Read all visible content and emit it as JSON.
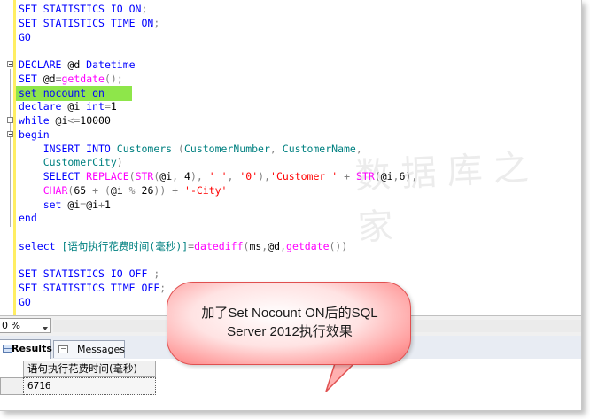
{
  "editor": {
    "lines": [
      {
        "segments": [
          {
            "t": "SET STATISTICS IO ON",
            "c": "k"
          },
          {
            "t": ";",
            "c": "g"
          }
        ]
      },
      {
        "segments": [
          {
            "t": "SET STATISTICS TIME ON",
            "c": "k"
          },
          {
            "t": ";",
            "c": "g"
          }
        ]
      },
      {
        "segments": [
          {
            "t": "GO",
            "c": "k"
          }
        ]
      },
      {
        "segments": []
      },
      {
        "marker": true,
        "segments": [
          {
            "t": "DECLARE ",
            "c": "k"
          },
          {
            "t": "@d ",
            "c": ""
          },
          {
            "t": "Datetime",
            "c": "k"
          }
        ]
      },
      {
        "segments": [
          {
            "t": "SET ",
            "c": "k"
          },
          {
            "t": "@d",
            "c": ""
          },
          {
            "t": "=",
            "c": "g"
          },
          {
            "t": "getdate",
            "c": "f"
          },
          {
            "t": "();",
            "c": "g"
          }
        ]
      },
      {
        "segments": [
          {
            "t": "set ",
            "c": "k"
          },
          {
            "t": "nocount ",
            "c": "k"
          },
          {
            "t": "on",
            "c": "k"
          }
        ]
      },
      {
        "segments": [
          {
            "t": "declare ",
            "c": "k"
          },
          {
            "t": "@i ",
            "c": ""
          },
          {
            "t": "int",
            "c": "k"
          },
          {
            "t": "=",
            "c": "g"
          },
          {
            "t": "1",
            "c": ""
          }
        ]
      },
      {
        "marker": true,
        "segments": [
          {
            "t": "while ",
            "c": "k"
          },
          {
            "t": "@i",
            "c": ""
          },
          {
            "t": "<=",
            "c": "g"
          },
          {
            "t": "10000",
            "c": ""
          }
        ]
      },
      {
        "marker": true,
        "segments": [
          {
            "t": "begin",
            "c": "k"
          }
        ]
      },
      {
        "segments": [
          {
            "t": "    INSERT INTO ",
            "c": "k"
          },
          {
            "t": "Customers ",
            "c": "c"
          },
          {
            "t": "(",
            "c": "g"
          },
          {
            "t": "CustomerNumber",
            "c": "c"
          },
          {
            "t": ", ",
            "c": "g"
          },
          {
            "t": "CustomerName",
            "c": "c"
          },
          {
            "t": ",",
            "c": "g"
          }
        ]
      },
      {
        "segments": [
          {
            "t": "    CustomerCity",
            "c": "c"
          },
          {
            "t": ")",
            "c": "g"
          }
        ]
      },
      {
        "segments": [
          {
            "t": "    SELECT ",
            "c": "k"
          },
          {
            "t": "REPLACE",
            "c": "f"
          },
          {
            "t": "(",
            "c": "g"
          },
          {
            "t": "STR",
            "c": "f"
          },
          {
            "t": "(",
            "c": "g"
          },
          {
            "t": "@i",
            "c": ""
          },
          {
            "t": ", ",
            "c": "g"
          },
          {
            "t": "4",
            "c": ""
          },
          {
            "t": "), ",
            "c": "g"
          },
          {
            "t": "' '",
            "c": "s"
          },
          {
            "t": ", ",
            "c": "g"
          },
          {
            "t": "'0'",
            "c": "s"
          },
          {
            "t": "),",
            "c": "g"
          },
          {
            "t": "'Customer '",
            "c": "s"
          },
          {
            "t": " + ",
            "c": "g"
          },
          {
            "t": "STR",
            "c": "f"
          },
          {
            "t": "(",
            "c": "g"
          },
          {
            "t": "@i",
            "c": ""
          },
          {
            "t": ",",
            "c": "g"
          },
          {
            "t": "6",
            "c": ""
          },
          {
            "t": "),",
            "c": "g"
          }
        ]
      },
      {
        "segments": [
          {
            "t": "    CHAR",
            "c": "f"
          },
          {
            "t": "(",
            "c": "g"
          },
          {
            "t": "65 ",
            "c": ""
          },
          {
            "t": "+ (",
            "c": "g"
          },
          {
            "t": "@i ",
            "c": ""
          },
          {
            "t": "% ",
            "c": "g"
          },
          {
            "t": "26",
            "c": ""
          },
          {
            "t": ")) + ",
            "c": "g"
          },
          {
            "t": "'-City'",
            "c": "s"
          }
        ]
      },
      {
        "segments": [
          {
            "t": "    set ",
            "c": "k"
          },
          {
            "t": "@i",
            "c": ""
          },
          {
            "t": "=",
            "c": "g"
          },
          {
            "t": "@i",
            "c": ""
          },
          {
            "t": "+",
            "c": "g"
          },
          {
            "t": "1",
            "c": ""
          }
        ]
      },
      {
        "segments": [
          {
            "t": "end",
            "c": "k"
          }
        ]
      },
      {
        "segments": []
      },
      {
        "segments": [
          {
            "t": "select ",
            "c": "k"
          },
          {
            "t": "[语句执行花费时间(毫秒)]",
            "c": "c"
          },
          {
            "t": "=",
            "c": "g"
          },
          {
            "t": "datediff",
            "c": "f"
          },
          {
            "t": "(",
            "c": "g"
          },
          {
            "t": "ms",
            "c": ""
          },
          {
            "t": ",",
            "c": "g"
          },
          {
            "t": "@d",
            "c": ""
          },
          {
            "t": ",",
            "c": "g"
          },
          {
            "t": "getdate",
            "c": "f"
          },
          {
            "t": "())",
            "c": "g"
          }
        ]
      },
      {
        "segments": []
      },
      {
        "segments": [
          {
            "t": "SET STATISTICS IO OFF ",
            "c": "k"
          },
          {
            "t": ";",
            "c": "g"
          }
        ]
      },
      {
        "segments": [
          {
            "t": "SET STATISTICS TIME OFF",
            "c": "k"
          },
          {
            "t": ";",
            "c": "g"
          }
        ]
      },
      {
        "segments": [
          {
            "t": "GO",
            "c": "k"
          }
        ]
      }
    ]
  },
  "zoom": {
    "value": "0 %"
  },
  "tabs": [
    {
      "label": "Results",
      "icon": "grid-icon",
      "active": true
    },
    {
      "label": "Messages",
      "icon": "messages-icon",
      "active": false
    }
  ],
  "results": {
    "column_header": "语句执行花费时间(毫秒)",
    "rows": [
      [
        "6716"
      ]
    ]
  },
  "watermark": {
    "text": "数据库之家"
  },
  "callout": {
    "line1": "加了Set Nocount ON后的SQL",
    "line2": "Server 2012执行效果"
  },
  "colors": {
    "keyword": "#0000ff",
    "function": "#ff00ff",
    "string": "#ff0000",
    "operator": "#808080",
    "identifier": "#008080",
    "highlight": "#8ee64a",
    "callout_border": "#e05050"
  }
}
